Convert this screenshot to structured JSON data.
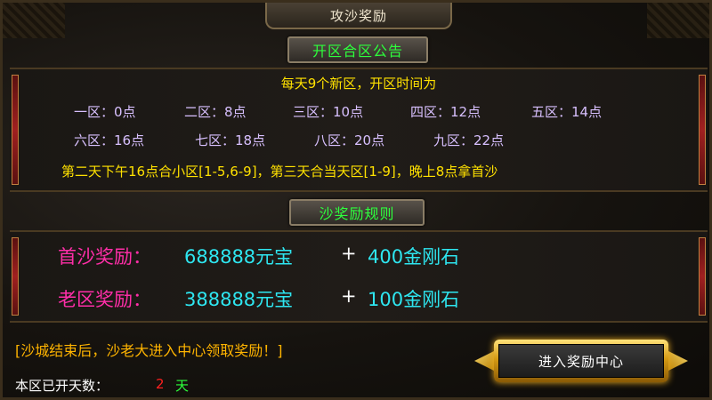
{
  "window": {
    "title": "攻沙奖励"
  },
  "notice": {
    "header": "开区合区公告",
    "headline": "每天9个新区，开区时间为",
    "zones_row1": [
      "一区：0点",
      "二区：8点",
      "三区：10点",
      "四区：12点",
      "五区：14点"
    ],
    "zones_row2": [
      "六区：16点",
      "七区：18点",
      "八区：20点",
      "九区：22点"
    ],
    "merge_text": "第二天下午16点合小区[1-5,6-9]，第三天合当天区[1-9]，晚上8点拿首沙"
  },
  "rules": {
    "header": "沙奖励规则",
    "rows": [
      {
        "label": "首沙奖励：",
        "yuanbao": "688888元宝",
        "plus": "+",
        "diamond": "400金刚石"
      },
      {
        "label": "老区奖励：",
        "yuanbao": "388888元宝",
        "plus": "+",
        "diamond": "100金刚石"
      }
    ]
  },
  "footer": {
    "note": "[沙城结束后，沙老大进入中心领取奖励！]",
    "days_label": "本区已开天数：",
    "days_value": "2",
    "days_unit": "天",
    "enter_button": "进入奖励中心"
  },
  "colors": {
    "header_green": "#2dff3c",
    "notice_yellow": "#ffe100",
    "zone_lavender": "#d8c0ff",
    "reward_pink": "#ff2ea8",
    "reward_cyan": "#2ee6f0",
    "note_orange": "#ffb400",
    "days_red": "#ff2020",
    "button_gold": "#d59a14"
  }
}
